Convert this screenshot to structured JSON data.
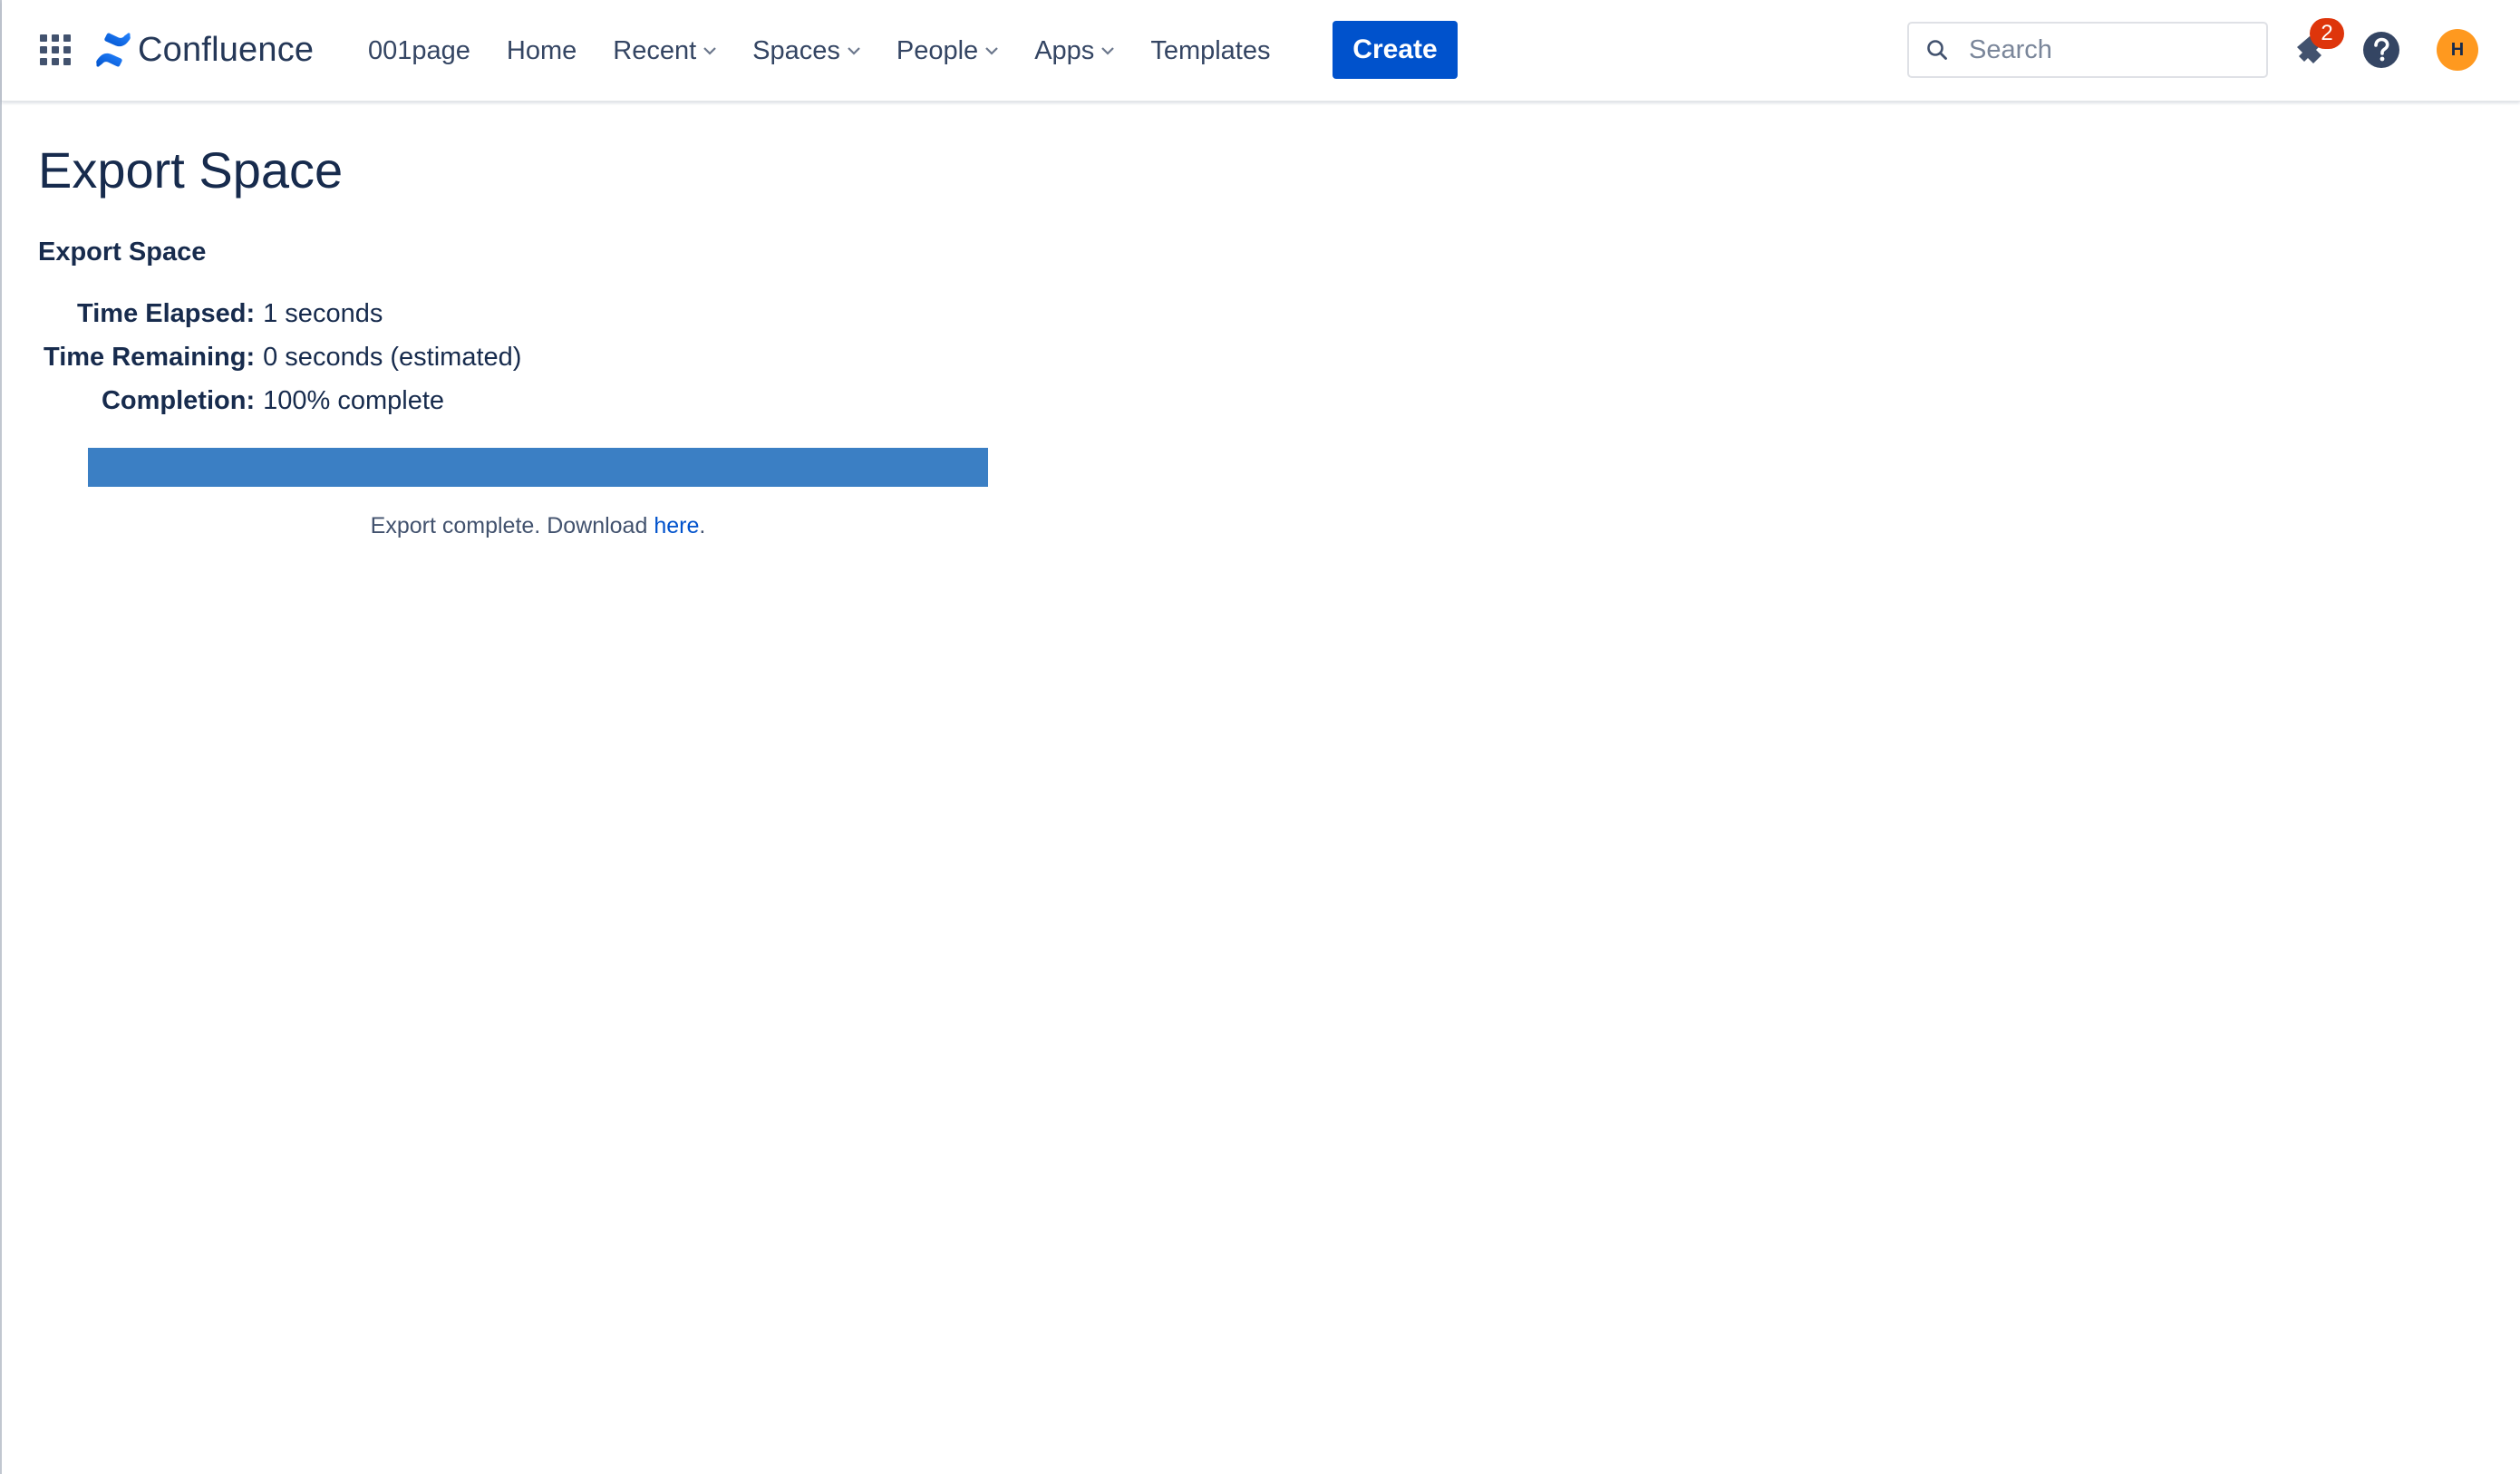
{
  "header": {
    "product_name": "Confluence",
    "nav": [
      {
        "label": "001page",
        "has_dropdown": false
      },
      {
        "label": "Home",
        "has_dropdown": false
      },
      {
        "label": "Recent",
        "has_dropdown": true
      },
      {
        "label": "Spaces",
        "has_dropdown": true
      },
      {
        "label": "People",
        "has_dropdown": true
      },
      {
        "label": "Apps",
        "has_dropdown": true
      },
      {
        "label": "Templates",
        "has_dropdown": false
      }
    ],
    "create_label": "Create",
    "search": {
      "placeholder": "Search",
      "value": ""
    },
    "notifications_count": "2",
    "avatar_initial": "H",
    "icons": [
      "app-switcher-icon",
      "confluence-logo-icon",
      "chevron-down-icon",
      "search-icon",
      "notification-icon",
      "help-icon"
    ]
  },
  "main": {
    "page_title": "Export Space",
    "section_title": "Export Space",
    "info": [
      {
        "label": "Time Elapsed:",
        "value": "1 seconds"
      },
      {
        "label": "Time Remaining:",
        "value": "0 seconds (estimated)"
      },
      {
        "label": "Completion:",
        "value": "100% complete"
      }
    ],
    "progress_percent": 100,
    "status_prefix": "Export complete. Download ",
    "status_link": "here",
    "status_suffix": "."
  },
  "colors": {
    "brand_blue": "#0052cc",
    "progress_fill": "#3b7fc4",
    "badge_red": "#de350b",
    "avatar_orange": "#ff991f",
    "text_dark": "#172b4d"
  }
}
